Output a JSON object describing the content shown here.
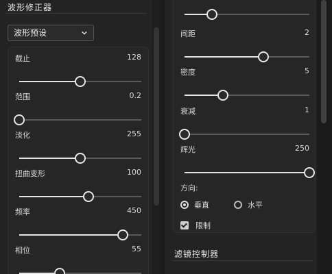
{
  "left_panel": {
    "title": "波形修正器",
    "preset": {
      "label": "波形预设"
    },
    "sliders": [
      {
        "label": "截止",
        "value": "128",
        "level": 0.5
      },
      {
        "label": "范围",
        "value": "0.2",
        "level": 0.0
      },
      {
        "label": "淡化",
        "value": "255",
        "level": 0.5
      },
      {
        "label": "扭曲变形",
        "value": "100",
        "level": 0.57
      },
      {
        "label": "频率",
        "value": "450",
        "level": 0.85
      },
      {
        "label": "相位",
        "value": "55",
        "level": 0.33
      }
    ]
  },
  "right_panel": {
    "top_slider": {
      "level": 0.22
    },
    "sliders": [
      {
        "label": "间距",
        "value": "2",
        "level": 0.63
      },
      {
        "label": "密度",
        "value": "5",
        "level": 0.31
      },
      {
        "label": "衰减",
        "value": "1",
        "level": 0.0
      },
      {
        "label": "辉光",
        "value": "250",
        "level": 1.0
      }
    ],
    "direction": {
      "label": "方向:",
      "options": [
        "垂直",
        "水平"
      ],
      "selected": "垂直"
    },
    "limit_checkbox": {
      "label": "限制",
      "checked": true
    },
    "section2_title": "滤镜控制器"
  }
}
